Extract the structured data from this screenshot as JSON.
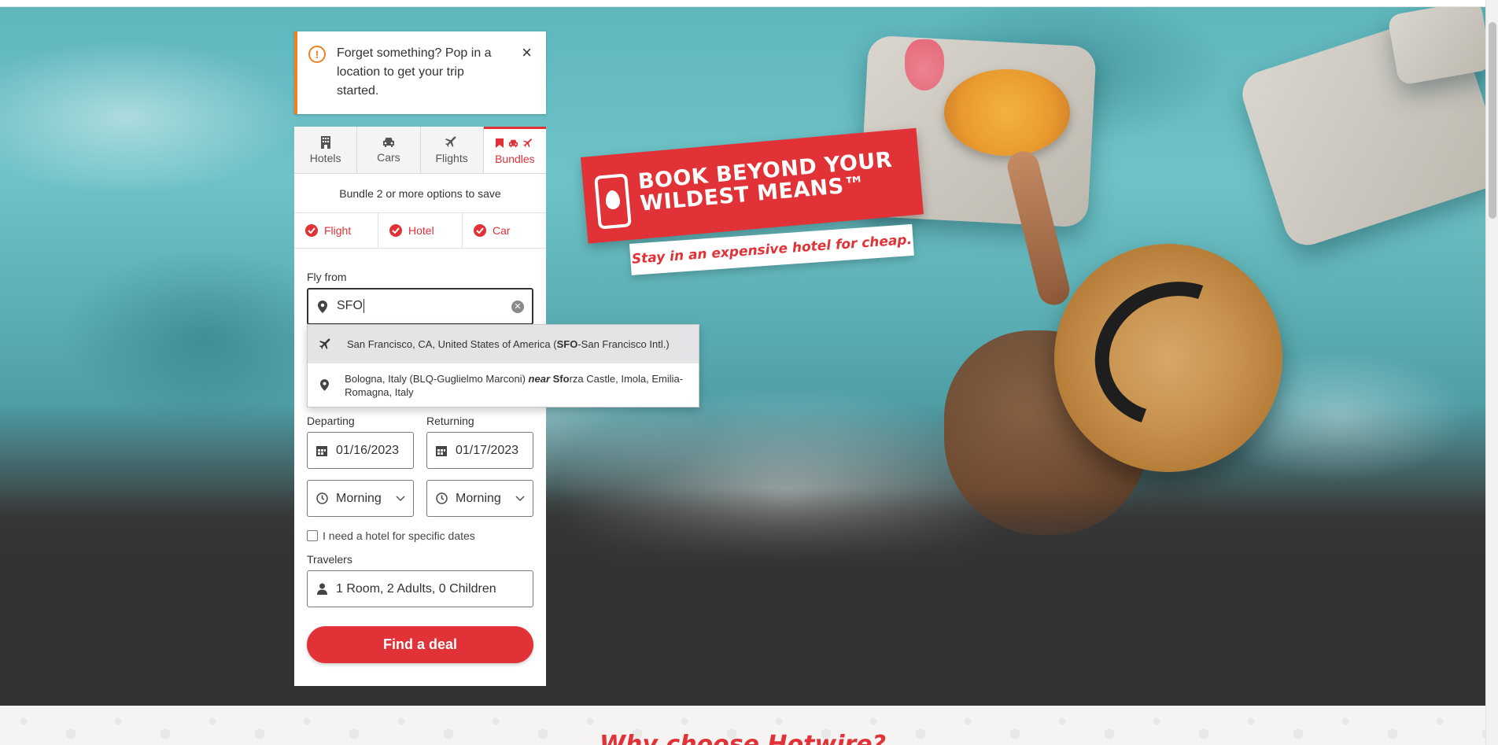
{
  "alert": {
    "icon": "warning-circle-icon",
    "text": "Forget something? Pop in a location to get your trip started.",
    "close_label": "×"
  },
  "tabs": [
    {
      "label": "Hotels",
      "icon": "hotel-icon",
      "active": false
    },
    {
      "label": "Cars",
      "icon": "car-icon",
      "active": false
    },
    {
      "label": "Flights",
      "icon": "plane-icon",
      "active": false
    },
    {
      "label": "Bundles",
      "icon": "bundle-icons",
      "active": true
    }
  ],
  "bundle_note": "Bundle 2 or more options to save",
  "bundle_options": [
    {
      "label": "Flight",
      "checked": true
    },
    {
      "label": "Hotel",
      "checked": true
    },
    {
      "label": "Car",
      "checked": true
    }
  ],
  "fly_from": {
    "label": "Fly from",
    "value": "SFO"
  },
  "suggestions": [
    {
      "icon": "plane-icon",
      "prefix": "San Francisco, CA, United States of America (",
      "bold": "SFO",
      "suffix": "-San Francisco Intl.)"
    },
    {
      "icon": "location-pin-icon",
      "prefix": "Bologna, Italy (BLQ-Guglielmo Marconi) ",
      "near": "near",
      "bold": "Sfo",
      "suffix": "rza Castle, Imola, Emilia-Romagna, Italy"
    }
  ],
  "departing": {
    "label": "Departing",
    "value": "01/16/2023"
  },
  "returning": {
    "label": "Returning",
    "value": "01/17/2023"
  },
  "depart_time": {
    "value": "Morning"
  },
  "return_time": {
    "value": "Morning"
  },
  "hotel_dates_checkbox": {
    "label": "I need a hotel for specific dates",
    "checked": false
  },
  "travelers": {
    "label": "Travelers",
    "value": "1 Room, 2 Adults, 0 Children"
  },
  "cta_label": "Find a deal",
  "promo": {
    "title": "BOOK BEYOND YOUR WILDEST MEANS™",
    "subtitle": "Stay in an expensive hotel for cheap."
  },
  "why_title": "Why choose Hotwire?",
  "colors": {
    "brand_red": "#e03237",
    "alert_orange": "#f0821e",
    "dark_band": "#333333"
  }
}
